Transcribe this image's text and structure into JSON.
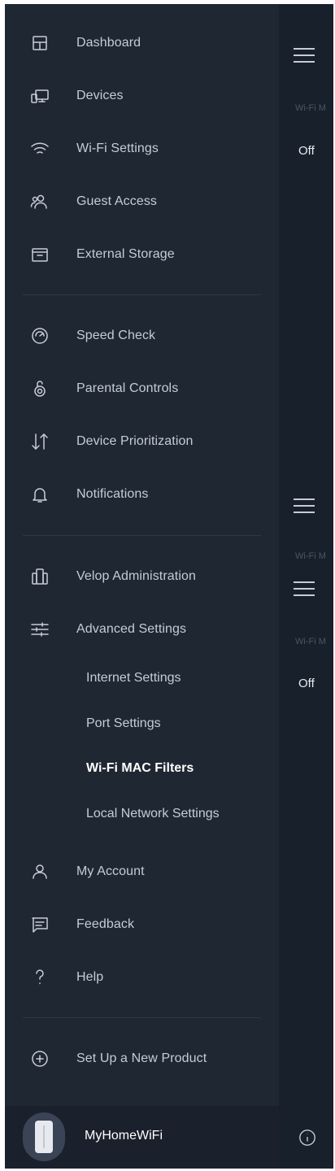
{
  "menu": {
    "items": [
      {
        "label": "Dashboard",
        "icon": "dashboard-icon"
      },
      {
        "label": "Devices",
        "icon": "devices-icon"
      },
      {
        "label": "Wi-Fi Settings",
        "icon": "wifi-icon"
      },
      {
        "label": "Guest Access",
        "icon": "guest-access-icon"
      },
      {
        "label": "External Storage",
        "icon": "external-storage-icon"
      },
      {
        "label": "Speed Check",
        "icon": "speed-check-icon"
      },
      {
        "label": "Parental Controls",
        "icon": "parental-controls-icon"
      },
      {
        "label": "Device Prioritization",
        "icon": "device-prioritization-icon"
      },
      {
        "label": "Notifications",
        "icon": "bell-icon"
      },
      {
        "label": "Velop Administration",
        "icon": "velop-admin-icon"
      },
      {
        "label": "Advanced Settings",
        "icon": "sliders-icon"
      },
      {
        "label": "My Account",
        "icon": "user-icon"
      },
      {
        "label": "Feedback",
        "icon": "feedback-icon"
      },
      {
        "label": "Help",
        "icon": "help-icon"
      },
      {
        "label": "Set Up a New Product",
        "icon": "add-circle-icon"
      }
    ],
    "advanced_subitems": [
      {
        "label": "Internet Settings"
      },
      {
        "label": "Port Settings"
      },
      {
        "label": "Wi-Fi MAC Filters",
        "active": true
      },
      {
        "label": "Local Network Settings"
      }
    ]
  },
  "footer": {
    "network_name": "MyHomeWiFi"
  },
  "background": {
    "label_1": "Wi-Fi M",
    "value_1": "Off",
    "label_2": "Wi-Fi M",
    "label_3": "Wi-Fi M",
    "value_2": "Off"
  },
  "colors": {
    "drawer_bg": "#1f2733",
    "panel_bg": "#18202b",
    "text": "#c5ccd6",
    "active_text": "#ffffff"
  }
}
